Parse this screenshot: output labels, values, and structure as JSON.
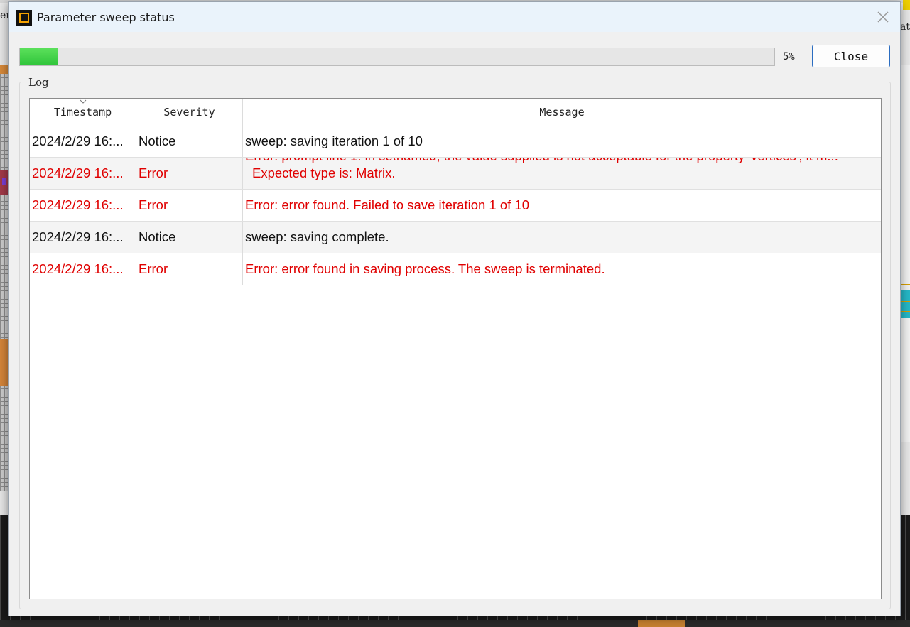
{
  "background": {
    "left_fragment": "er",
    "right_fragment": "at"
  },
  "dialog": {
    "title": "Parameter sweep status",
    "icon": "app-logo-icon",
    "close_icon": "close-icon"
  },
  "progress": {
    "value_percent": 5,
    "label": "5%"
  },
  "buttons": {
    "close_label": "Close"
  },
  "log": {
    "group_label": "Log",
    "columns": [
      "Timestamp",
      "Severity",
      "Message"
    ],
    "sorted_column": "Timestamp",
    "rows": [
      {
        "timestamp": "2024/2/29 16:...",
        "severity": "Notice",
        "message": "sweep: saving iteration 1 of 10"
      },
      {
        "timestamp": "2024/2/29 16:...",
        "severity": "Error",
        "message": "Error: prompt line 1: in setnamed, the value supplied is not acceptable for the property 'vertices', it m...",
        "message_line2": "Expected type is: Matrix."
      },
      {
        "timestamp": "2024/2/29 16:...",
        "severity": "Error",
        "message": "Error: error found. Failed to save iteration 1 of 10"
      },
      {
        "timestamp": "2024/2/29 16:...",
        "severity": "Notice",
        "message": "sweep: saving complete."
      },
      {
        "timestamp": "2024/2/29 16:...",
        "severity": "Error",
        "message": "Error: error found in saving process. The sweep is terminated."
      }
    ]
  },
  "colors": {
    "error_text": "#e00000",
    "notice_text": "#111111",
    "progress_fill": "#3ecf45",
    "accent_border": "#2b6dc1",
    "icon_orange": "#f3a100"
  }
}
